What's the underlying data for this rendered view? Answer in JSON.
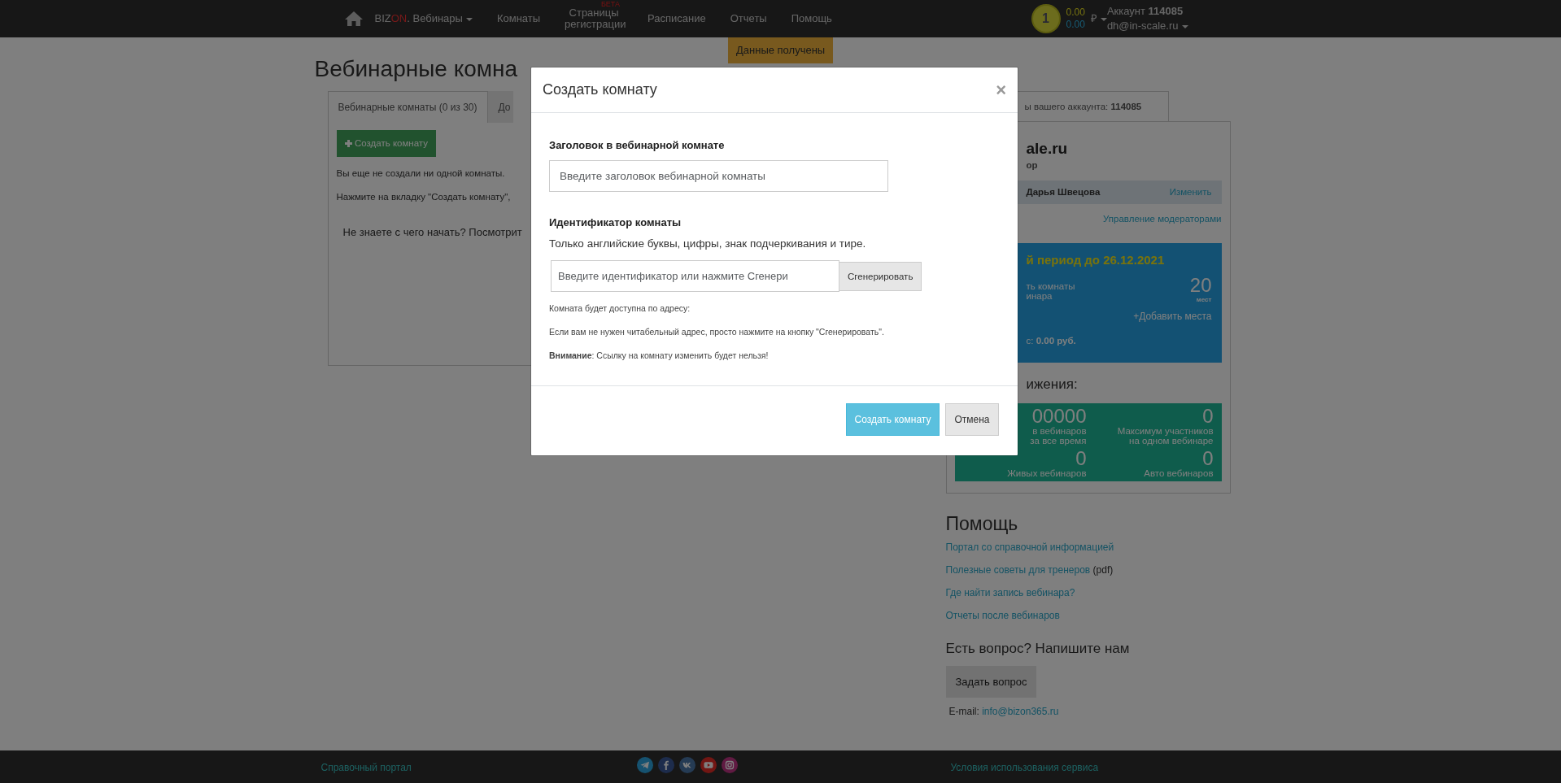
{
  "navbar": {
    "brand": [
      {
        "text": "BIZ",
        "kind": "plain"
      },
      {
        "text": "ON",
        "kind": "accent"
      },
      {
        "text": ". Вебинары",
        "kind": "plain"
      }
    ],
    "brand_dropdown": true,
    "items": [
      {
        "label": "Комнаты"
      },
      {
        "label": "Страницы регистрации",
        "badge": "БЕТА"
      },
      {
        "label": "Расписание"
      },
      {
        "label": "Отчеты"
      },
      {
        "label": "Помощь"
      }
    ],
    "coin": "1",
    "balance": {
      "main": "0.00",
      "bonus": "0.00",
      "currency": "₽"
    },
    "account": {
      "label": "Аккаунт **114085**",
      "email": "dh@in-scale.ru"
    }
  },
  "notification": "Данные получены",
  "page_title": "Вебинарные комна",
  "rooms_panel": {
    "tabs": [
      {
        "label": "Вебинарные комнаты (0 из 30)",
        "selected": true
      },
      {
        "label": "До",
        "selected": false
      }
    ],
    "create_button": "Создать комнату",
    "messages": [
      "Вы еще не создали ни одной комнаты.",
      "Нажмите на вкладку \"Создать комнату\","
    ],
    "hint": "Не знаете с чего начать? Посмотрит"
  },
  "account_panel": {
    "tab": "ы вашего аккаунта: **114085**",
    "domain": "ale.ru",
    "role": "ор",
    "moderator": {
      "name": "Дарья Швецова",
      "action": "Изменить"
    },
    "manage_link": "Управление модераторами",
    "tariff": {
      "period": "й период до 26.12.2021",
      "features": [
        "ть комнаты",
        "инара"
      ],
      "seats": "20",
      "seats_unit": "мест",
      "add_link": "+Добавить места",
      "balance": "с: **0.00 руб.**"
    },
    "achievements_title": "ижения:",
    "stats": [
      {
        "value": "00000",
        "lines": [
          "в вебинаров",
          "за все время"
        ]
      },
      {
        "value": "0",
        "lines": [
          "Максимум участников",
          "на одном вебинаре"
        ]
      },
      {
        "value": "0",
        "lines": [
          "Живых вебинаров"
        ]
      },
      {
        "value": "0",
        "lines": [
          "Авто вебинаров"
        ]
      }
    ]
  },
  "help": {
    "title": "Помощь",
    "links": [
      {
        "text": "Портал со справочной информацией"
      },
      {
        "text": "Полезные советы для тренеров",
        "note": "(pdf)"
      },
      {
        "text": "Где найти запись вебинара?"
      },
      {
        "text": "Отчеты после вебинаров"
      }
    ]
  },
  "contact": {
    "title": "Есть вопрос? Напишите нам",
    "button": "Задать вопрос",
    "email_label": "E-mail:",
    "email": "info@bizon365.ru"
  },
  "modal": {
    "title": "Создать комнату",
    "close": "×",
    "fields": [
      {
        "label": "Заголовок в вебинарной комнате",
        "placeholder": "Введите заголовок вебинарной комнаты"
      },
      {
        "label": "Идентификатор комнаты",
        "help": "Только английские буквы, цифры, знак подчеркивания и тире.",
        "placeholder": "Введите идентификатор или нажмите Сгенери",
        "button": "Сгенерировать"
      }
    ],
    "notes": [
      "Комната будет доступна по адресу:",
      "Если вам не нужен читабельный адрес, просто нажмите на кнопку \"Сгенерировать\".",
      "**Внимание**: Ссылку на комнату изменить будет нельзя!"
    ],
    "buttons": [
      {
        "label": "Создать комнату",
        "kind": "primary"
      },
      {
        "label": "Отмена",
        "kind": "secondary"
      }
    ]
  },
  "footer": {
    "left_link": "Справочный портал",
    "right_link": "Условия использования сервиса"
  }
}
